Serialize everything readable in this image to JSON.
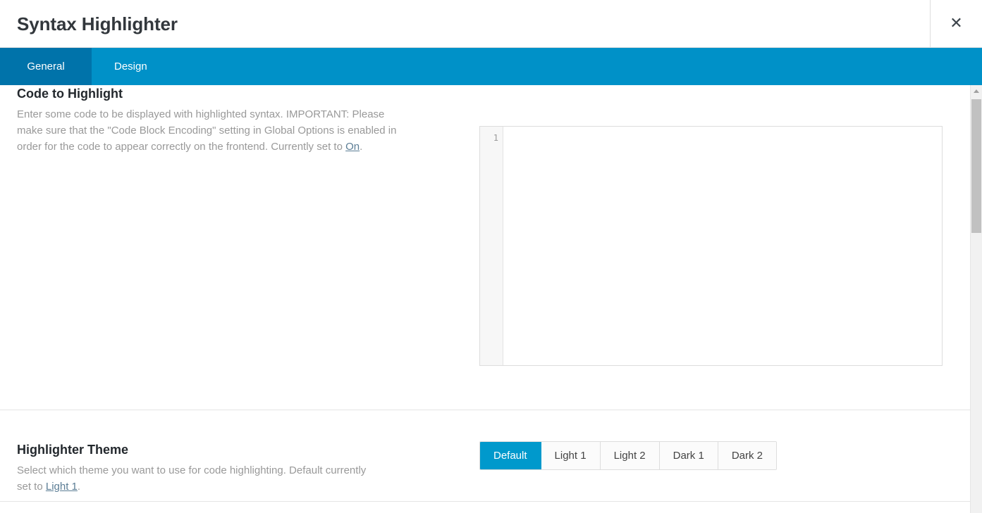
{
  "header": {
    "title": "Syntax Highlighter",
    "close_label": "✕"
  },
  "tabs": [
    {
      "label": "General",
      "active": true
    },
    {
      "label": "Design",
      "active": false
    }
  ],
  "rows": {
    "code": {
      "title": "Code to Highlight",
      "desc_part1": "Enter some code to be displayed with highlighted syntax. IMPORTANT: Please make sure that the \"Code Block Encoding\" setting in Global Options is enabled in order for the code to appear correctly on the frontend. Currently set to ",
      "link_text": "On",
      "desc_part2": ".",
      "editor": {
        "line_number": "1",
        "value": "",
        "placeholder": ""
      }
    },
    "theme": {
      "title": "Highlighter Theme",
      "desc_part1": "Select which theme you want to use for code highlighting. Default currently set to ",
      "link_text": "Light 1",
      "desc_part2": ".",
      "options": [
        {
          "label": "Default",
          "selected": true
        },
        {
          "label": "Light 1",
          "selected": false
        },
        {
          "label": "Light 2",
          "selected": false
        },
        {
          "label": "Dark 1",
          "selected": false
        },
        {
          "label": "Dark 2",
          "selected": false
        }
      ],
      "selected_option": "Default"
    }
  },
  "colors": {
    "tab_bar": "#0091c8",
    "tab_active": "#0073aa",
    "accent": "#0099cc",
    "link": "#5b7d95",
    "title": "#32373c",
    "muted_text": "#999999"
  },
  "scrollbar": {
    "up_arrow": "scroll-up-arrow"
  }
}
